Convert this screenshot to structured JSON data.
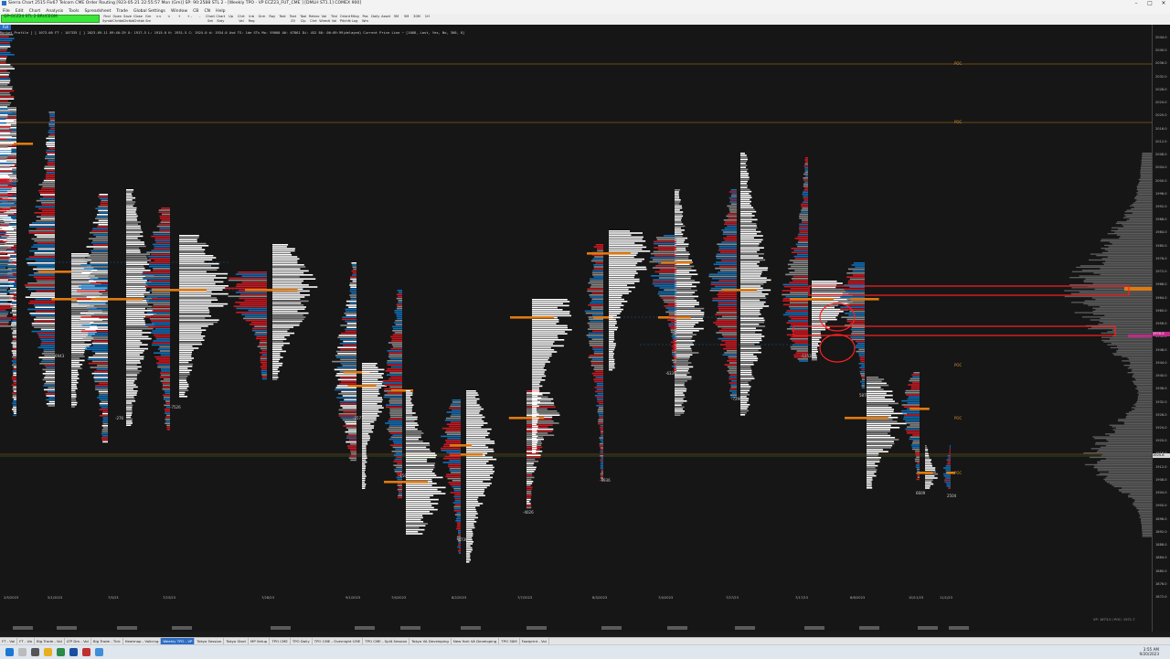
{
  "window": {
    "title": "Sierra Chart 2515 Fiv67 Telcom CME Order Routing [923-05-21  22:55:57 Mon (Gm)]  SP: 90:2588  STL 2 - [Weekly TPO - VP ECZ23_FUT_CME ] [DMLH ST1.1] COMEX 900]",
    "controls": [
      "–",
      "□",
      "✕"
    ]
  },
  "menu": [
    "File",
    "Edit",
    "Chart",
    "Analysis",
    "Tools",
    "Spreadsheet",
    "Trade",
    "Global Settings",
    "Window",
    "CB",
    "CN",
    "Help"
  ],
  "toolbar": {
    "symbol_box": "GP-GCZ24  STL 2  BRUCEOM",
    "buttons": [
      "Find Symbl",
      "Open Chrtbk",
      "Save Chrtbk",
      "Close Chrtbk",
      "Gm Sm",
      "<<",
      "<",
      "+",
      "+ -",
      "-",
      "Chart Set",
      "Chart Stdy",
      "Up",
      "Chrt Val",
      "Inb Reg",
      "Grm",
      "Ray",
      "Text",
      "Text Zll",
      "Tool Clp",
      "Retrac Chrt",
      "Val Wiredt",
      "Trivl Vol",
      "Orient Pitchfk",
      "Mkrg Log",
      "Pos Wrn",
      "Daily",
      "Asset",
      "5M",
      "5M",
      "30M",
      "1H"
    ]
  },
  "chart": {
    "tab_label": "Fut",
    "info_line": "Market Profile  [    ] 1073.00  FT : 107335 [    ] 2023-09-11 09:40:29 O: 1917.5 L: 1915.0 H: 1931.5 C: 1924.0 d: 1934.0 Avd TS: 1de STs Mo: 59000 A0: 67861 Di: 452 80: 00:09:99(delayed) Current Price Line  ~  [1008, Last, Yes, No, 300, 8]",
    "price_ticks": [
      "2044.0",
      "2040.0",
      "2036.0",
      "2032.0",
      "2028.0",
      "2024.0",
      "2020.0",
      "2016.0",
      "2012.0",
      "2008.0",
      "2004.0",
      "2000.0",
      "1996.0",
      "1992.0",
      "1988.0",
      "1984.0",
      "1980.0",
      "1976.0",
      "1972.0",
      "1968.0",
      "1964.0",
      "1960.0",
      "1956.0",
      "1952.0",
      "1948.0",
      "1944.0",
      "1940.0",
      "1936.0",
      "1932.0",
      "1928.0",
      "1924.0",
      "1920.0",
      "1916.0",
      "1912.0",
      "1908.0",
      "1904.0",
      "1900.0",
      "1896.0",
      "1892.0",
      "1888.0",
      "1884.0",
      "1880.0",
      "1876.0",
      "1872.0"
    ],
    "date_labels": [
      "2/5/2023",
      "5/1/2023",
      "7/5/23",
      "7/23/23",
      "7/28/23",
      "9/1/2023",
      "7/4/2023",
      "8/2/2023",
      "7/7/2023",
      "8/3/2023",
      "7/4/2023",
      "7/27/23",
      "7/17/23",
      "8/6/2023",
      "10/11/23",
      "11/1/23"
    ],
    "delta_labels": [
      "-4035",
      "6943",
      "-276",
      "-7526",
      "-2577",
      "-150",
      "-4739",
      "-4026",
      "-4936",
      "-6339",
      "-7298",
      "-1253",
      "5876",
      "6609",
      "2504"
    ],
    "level_labels": [
      "POC",
      "POC",
      "POC",
      "POC",
      "POC"
    ],
    "highlight_price": "1970.0",
    "current_price": "1925.6",
    "corner_note": "VP: 1873.0 /  POC: 1971.7"
  },
  "sheet_tabs": [
    "FT - Vol",
    "FT - Ub",
    "Big Trade - Vol",
    "LTP Dm - Vol",
    "Big Trade - Tick",
    "Heatmap - Volicing",
    "Weekly TPO - VP",
    "Tokyo Session",
    "Tokyo Start",
    "MP Setup",
    "TPO CME",
    "TPO Daily",
    "TPO CME - Overnight CME",
    "TPO CME - Split Session",
    "Tokyo VA Developing",
    "New York VA Developing",
    "TPO 30M",
    "Footprint - Vol"
  ],
  "active_sheet": "Weekly TPO - VP",
  "taskbar": {
    "time": "3:55 AM",
    "date": "9/20/2023"
  },
  "colors": {
    "up": "#0f6fb8",
    "down": "#d01820",
    "white": "#ffffff",
    "gray": "#8a8a8a",
    "poc": "#e07a10",
    "annotation": "#ff2020",
    "volume_profile": "#5c5c5c"
  }
}
